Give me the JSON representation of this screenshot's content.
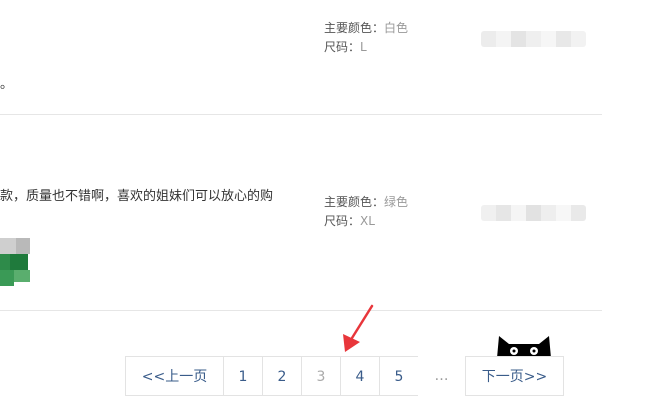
{
  "reviews": [
    {
      "text_tail": "。",
      "sku": {
        "color_label": "主要颜色：",
        "color_value": "白色",
        "size_label": "尺码：",
        "size_value": "L"
      }
    },
    {
      "text_tail": "款，质量也不错啊，喜欢的姐妹们可以放心的购",
      "sku": {
        "color_label": "主要颜色：",
        "color_value": "绿色",
        "size_label": "尺码：",
        "size_value": "XL"
      }
    }
  ],
  "pagination": {
    "prev": "<<上一页",
    "pages": [
      "1",
      "2",
      "3",
      "4",
      "5"
    ],
    "current": "3",
    "ellipsis": "…",
    "next": "下一页>>"
  },
  "icons": {
    "annotation_arrow": "red-arrow-icon",
    "brand_logo": "tmall-cat-icon"
  },
  "colors": {
    "accent_arrow": "#e8363b",
    "link": "#3a5c8a",
    "divider": "#e6e6e6"
  }
}
